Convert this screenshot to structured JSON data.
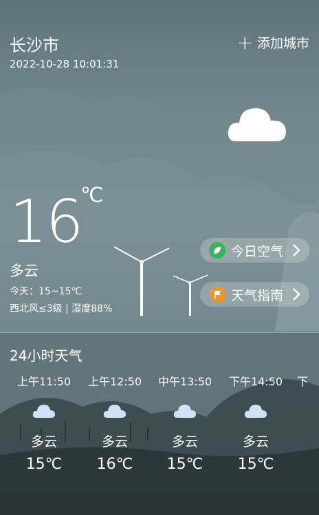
{
  "header": {
    "city": "长沙市",
    "datetime": "2022-10-28 10:01:31",
    "add_city_label": "添加城市"
  },
  "current": {
    "temperature": "16",
    "unit": "℃",
    "condition": "多云",
    "range": "今天：15~15℃",
    "wind_humidity": "西北风≤3级 | 湿度88%"
  },
  "actions": {
    "air_quality": "今日空气",
    "guide": "天气指南"
  },
  "hourly": {
    "title": "24小时天气",
    "items": [
      {
        "time": "上午11:50",
        "condition": "多云",
        "temp": "15℃"
      },
      {
        "time": "上午12:50",
        "condition": "多云",
        "temp": "16℃"
      },
      {
        "time": "中午13:50",
        "condition": "多云",
        "temp": "15℃"
      },
      {
        "time": "下午14:50",
        "condition": "多云",
        "temp": "15℃"
      },
      {
        "time": "下",
        "condition": "",
        "temp": ""
      }
    ]
  },
  "colors": {
    "leaf_icon": "#34b55a",
    "flag_icon": "#e8962e",
    "cloud_small": "#cfe2f7"
  },
  "icons": [
    "plus-icon",
    "cloud-icon",
    "leaf-icon",
    "flag-icon",
    "chevron-right-icon",
    "wind-turbine-icon"
  ]
}
